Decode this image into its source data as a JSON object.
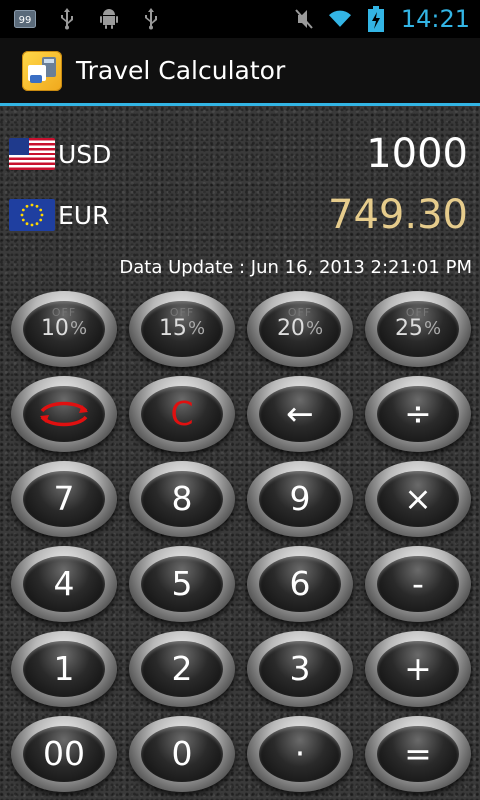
{
  "status_bar": {
    "time": "14:21",
    "notification_badge": "99",
    "icons_left": [
      "notification-badge-icon",
      "usb-icon",
      "android-icon",
      "usb-icon"
    ],
    "icons_right": [
      "mute-icon",
      "wifi-icon",
      "battery-charging-icon"
    ]
  },
  "app_bar": {
    "title": "Travel Calculator",
    "icon": "calculator-app-icon"
  },
  "currencies": [
    {
      "code": "USD",
      "value": "1000",
      "flag": "us-flag-icon"
    },
    {
      "code": "EUR",
      "value": "749.30",
      "flag": "eu-flag-icon"
    }
  ],
  "update_text": "Data Update : Jun 16, 2013 2:21:01 PM",
  "off_label": "OFF",
  "percent_symbol": "%",
  "discount_keys": [
    "10",
    "15",
    "20",
    "25"
  ],
  "keys": {
    "swap": "swap-currencies-icon",
    "clear": "C",
    "backspace": "←",
    "divide": "÷",
    "seven": "7",
    "eight": "8",
    "nine": "9",
    "multiply": "×",
    "four": "4",
    "five": "5",
    "six": "6",
    "minus": "-",
    "one": "1",
    "two": "2",
    "three": "3",
    "plus": "+",
    "double_zero": "00",
    "zero": "0",
    "decimal": "·",
    "equals": "="
  },
  "colors": {
    "accent": "#33b5e5",
    "converted_value": "#e6cc8c",
    "clear_key": "#e01010"
  }
}
